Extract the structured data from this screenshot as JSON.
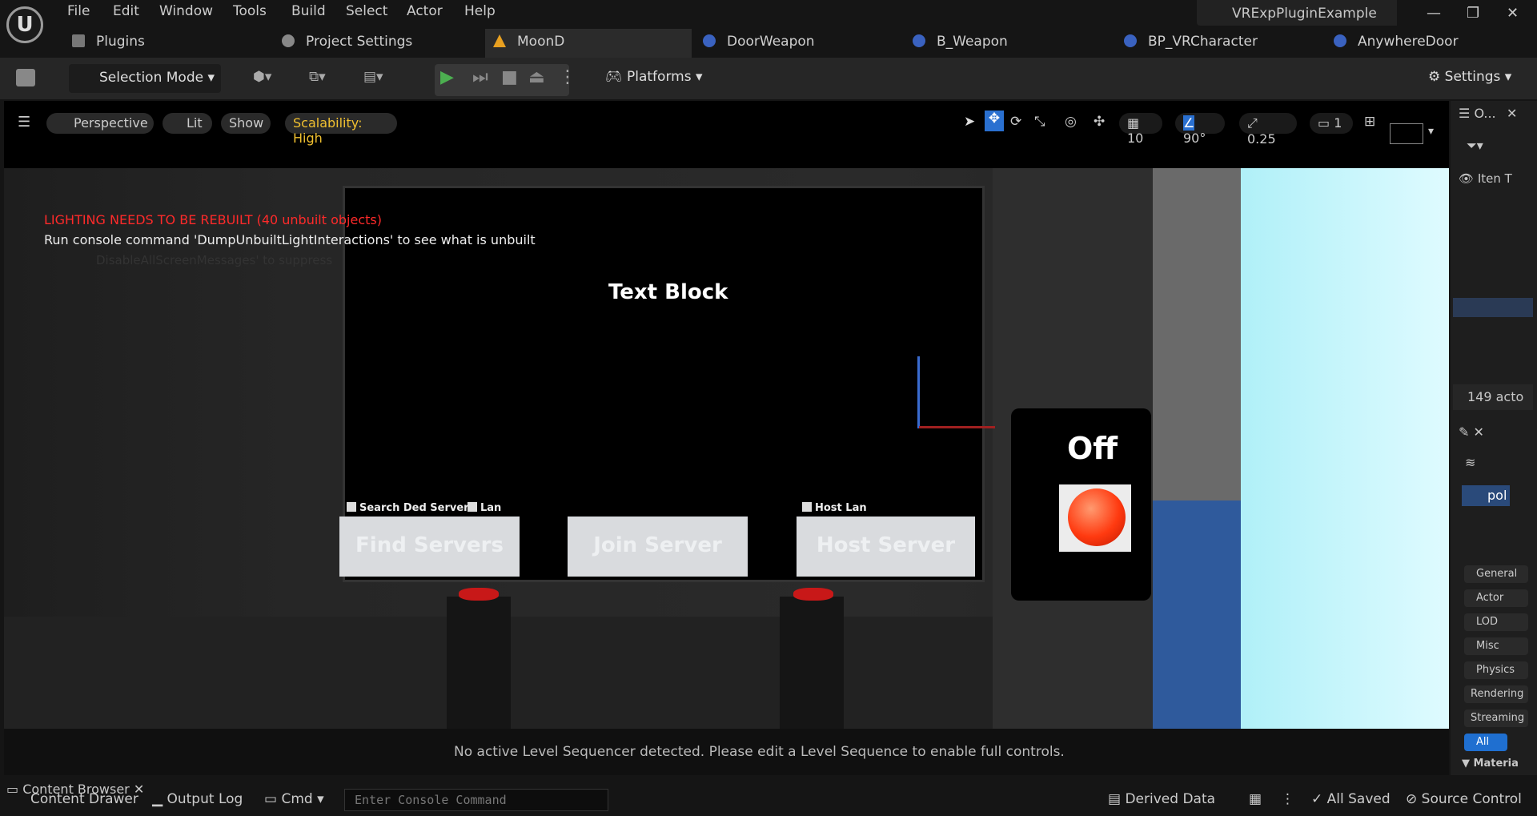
{
  "menu": [
    "File",
    "Edit",
    "Window",
    "Tools",
    "Build",
    "Select",
    "Actor",
    "Help"
  ],
  "project_name": "VRExpPluginExample",
  "tabs": [
    {
      "label": "Plugins",
      "icon": "plug-icon"
    },
    {
      "label": "Project Settings",
      "icon": "gear-icon"
    },
    {
      "label": "MoonD",
      "icon": "level-icon"
    },
    {
      "label": "DoorWeapon",
      "icon": "blueprint-icon"
    },
    {
      "label": "B_Weapon",
      "icon": "blueprint-icon"
    },
    {
      "label": "BP_VRCharacter",
      "icon": "character-icon"
    },
    {
      "label": "AnywhereDoor",
      "icon": "blueprint-icon"
    }
  ],
  "toolbar": {
    "mode": "Selection Mode",
    "platforms": "Platforms",
    "settings": "Settings"
  },
  "viewport": {
    "view": "Perspective",
    "lit": "Lit",
    "show": "Show",
    "scalability": "Scalability: High",
    "grid": "10",
    "angle": "90°",
    "scale": "0.25",
    "camera": "1"
  },
  "messages": {
    "lighting": "LIGHTING NEEDS TO BE REBUILT (40 unbuilt objects)",
    "console_hint": "Run console command 'DumpUnbuiltLightInteractions' to see what is unbuilt",
    "suppress": "DisableAllScreenMessages' to suppress"
  },
  "scene": {
    "text_block": "Text Block",
    "search_ded": "Search Ded Servers",
    "lan": "Lan",
    "host_lan": "Host Lan",
    "find": "Find Servers",
    "join": "Join Server",
    "host": "Host Server",
    "switch": "Off"
  },
  "sequencer_msg": "No active Level Sequencer detected. Please edit a Level Sequence to enable full controls.",
  "outliner": {
    "title": "O...",
    "item_col": "Iten T",
    "actors": "149 acto",
    "layer": "pol",
    "categories": [
      "General",
      "Actor",
      "LOD",
      "Misc",
      "Physics",
      "Rendering",
      "Streaming",
      "All"
    ],
    "material": "Materia"
  },
  "status": {
    "content_browser": "Content Browser",
    "content_drawer": "Content Drawer",
    "output_log": "Output Log",
    "cmd": "Cmd",
    "console_placeholder": "Enter Console Command",
    "derived": "Derived Data",
    "saved": "All Saved",
    "source": "Source Control"
  }
}
